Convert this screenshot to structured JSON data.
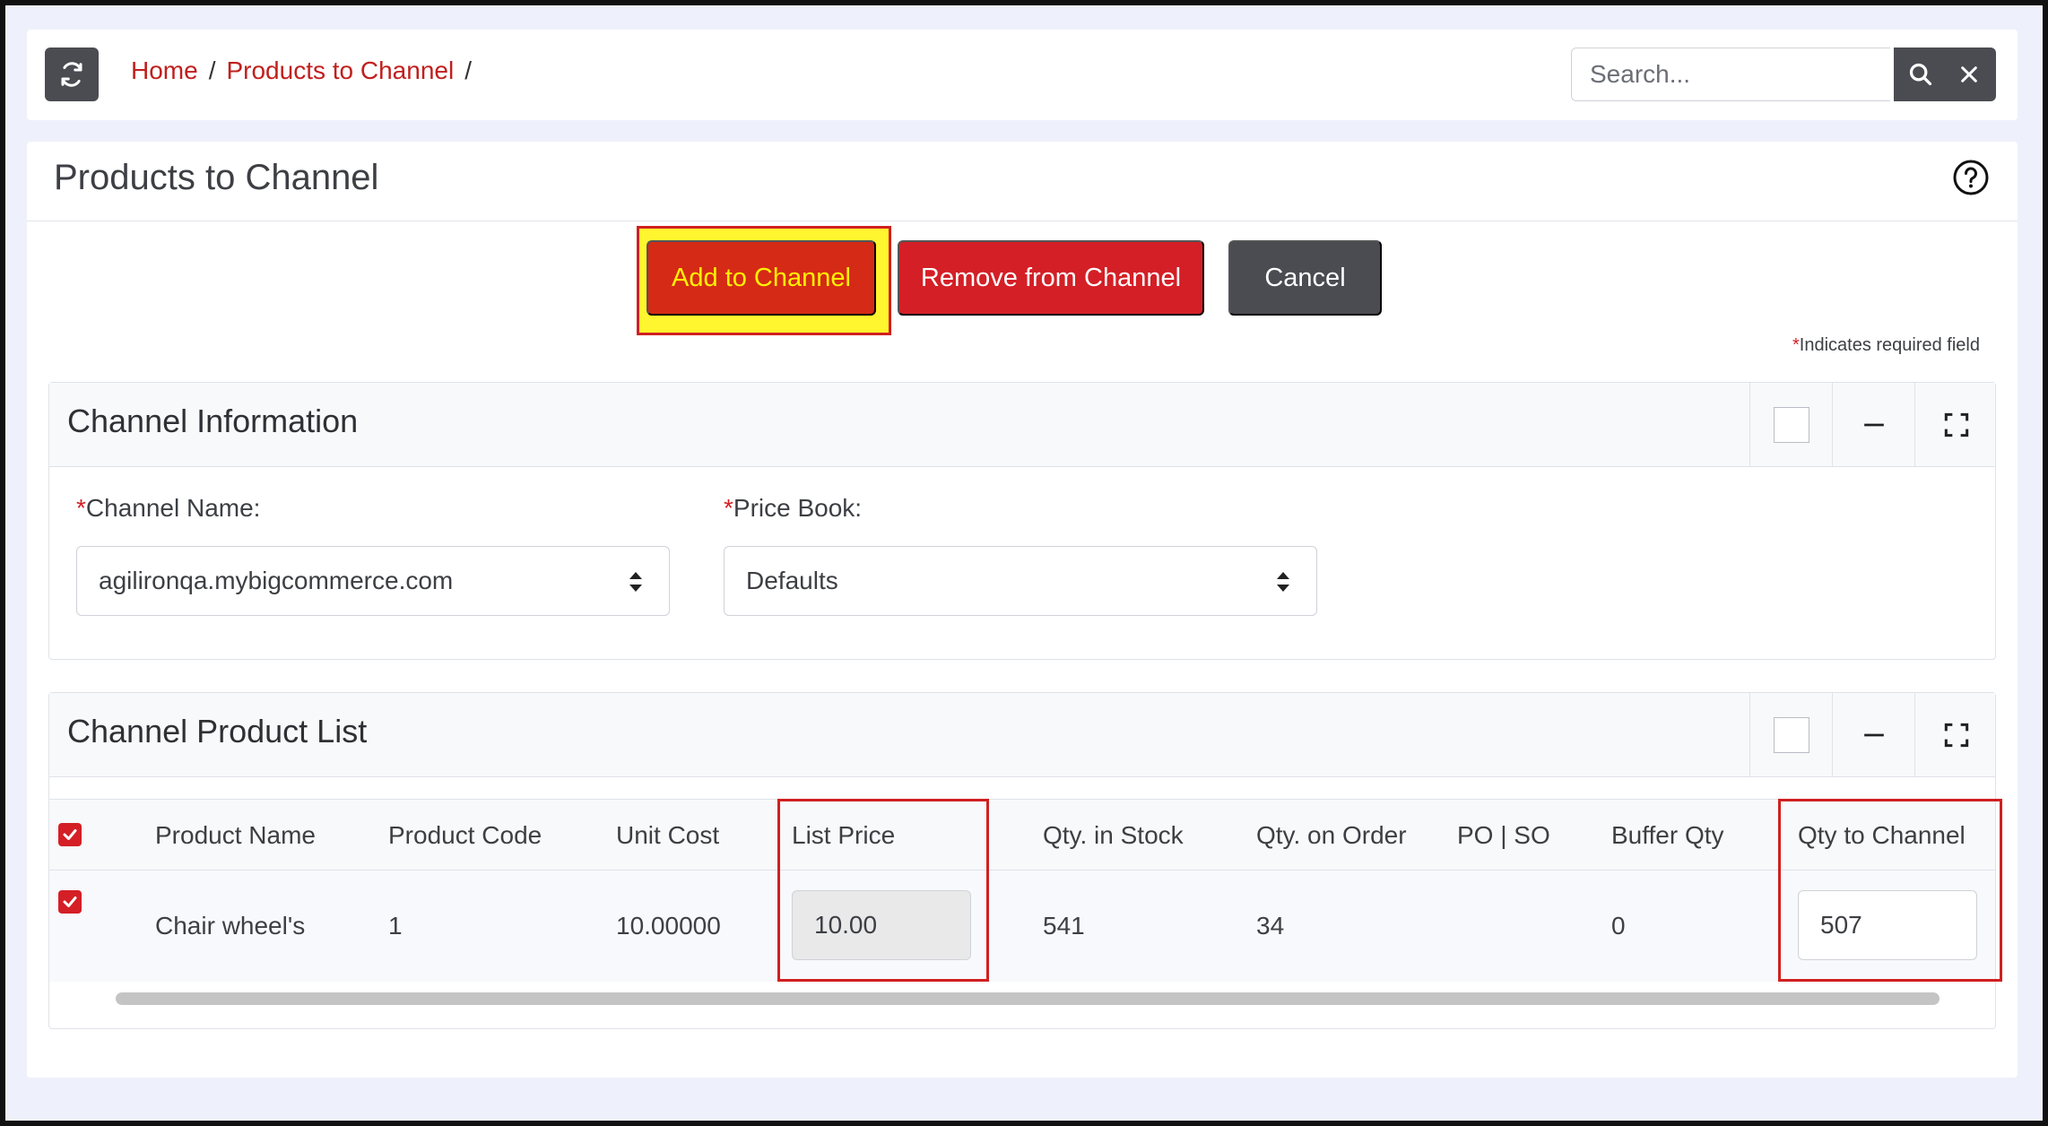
{
  "header": {
    "breadcrumbs": [
      "Home",
      "Products to Channel"
    ],
    "breadcrumb_separator": "/",
    "search": {
      "placeholder": "Search...",
      "value": ""
    },
    "icons": {
      "refresh": "refresh-icon",
      "search": "search-icon",
      "clear": "close-icon"
    }
  },
  "page": {
    "title": "Products to Channel",
    "help_icon": "question-circle-icon",
    "actions": {
      "add": "Add to Channel",
      "remove": "Remove from Channel",
      "cancel": "Cancel"
    },
    "required_star": "*",
    "required_note": "Indicates required field"
  },
  "channel_info": {
    "title": "Channel Information",
    "channel_name_label": "Channel Name:",
    "channel_name_value": "agilironqa.mybigcommerce.com",
    "price_book_label": "Price Book:",
    "price_book_value": "Defaults"
  },
  "product_list": {
    "title": "Channel Product List",
    "columns": [
      "Product Name",
      "Product Code",
      "Unit Cost",
      "List Price",
      "Qty. in Stock",
      "Qty. on Order",
      "PO | SO",
      "Buffer Qty",
      "Qty to Channel"
    ],
    "rows": [
      {
        "product_name": "Chair wheel's",
        "product_code": "1",
        "unit_cost": "10.00000",
        "list_price": "10.00",
        "qty_in_stock": "541",
        "qty_on_order": "34",
        "po_so": "",
        "buffer_qty": "0",
        "qty_to_channel": "507"
      }
    ]
  },
  "colors": {
    "accent_red": "#d41f26",
    "highlight_yellow": "#fff62f",
    "dark_button": "#4a4c52"
  }
}
